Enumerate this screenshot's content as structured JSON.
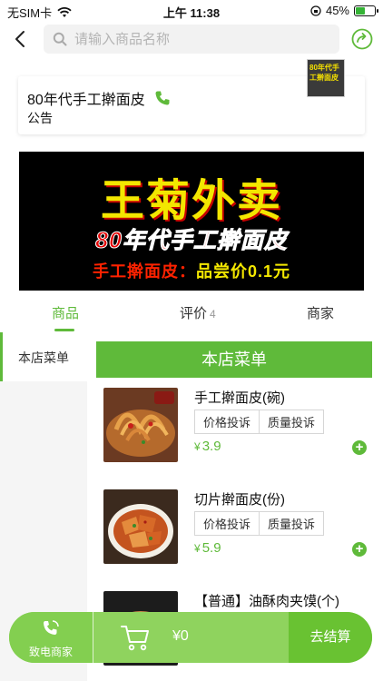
{
  "status_bar": {
    "carrier": "无SIM卡",
    "time": "上午 11:38",
    "battery": "45%",
    "battery_level": 0.45
  },
  "search": {
    "placeholder": "请输入商品名称"
  },
  "shop": {
    "name": "80年代手工擀面皮",
    "notice_label": "公告",
    "logo_text": "80年代手工擀面皮"
  },
  "banner": {
    "line1": "王菊外卖",
    "line2": "80年代手工擀面皮",
    "line3_prefix": "手工擀面皮：",
    "line3_highlight": "品尝价0.1元"
  },
  "tabs": [
    {
      "label": "商品",
      "badge": ""
    },
    {
      "label": "评价",
      "badge": "4"
    },
    {
      "label": "商家",
      "badge": ""
    }
  ],
  "sidebar": {
    "items": [
      {
        "label": "本店菜单"
      }
    ]
  },
  "menu": {
    "header": "本店菜单",
    "products": [
      {
        "name": "手工擀面皮(碗)",
        "tag1": "价格投诉",
        "tag2": "质量投诉",
        "currency": "¥",
        "price": "3.9"
      },
      {
        "name": "切片擀面皮(份)",
        "tag1": "价格投诉",
        "tag2": "质量投诉",
        "currency": "¥",
        "price": "5.9"
      },
      {
        "name": "【普通】油酥肉夹馍(个)",
        "tag1": "",
        "tag2": "",
        "currency": "",
        "price": ""
      }
    ]
  },
  "cart": {
    "call_label": "致电商家",
    "amount": "¥0",
    "checkout_label": "去结算"
  },
  "colors": {
    "accent": "#5fba3a",
    "banner_yellow": "#f3e700",
    "banner_red": "#e40000"
  }
}
